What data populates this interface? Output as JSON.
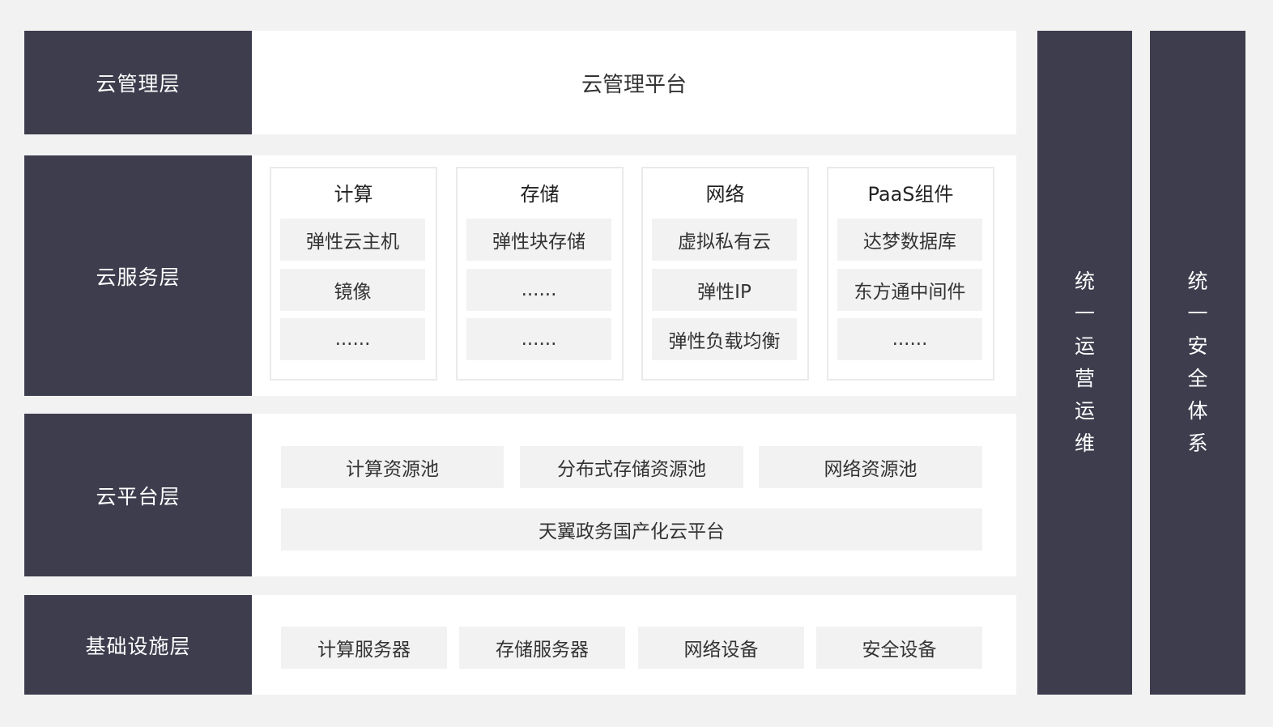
{
  "layers": {
    "management": {
      "label": "云管理层",
      "platform": "云管理平台"
    },
    "service": {
      "label": "云服务层",
      "cards": [
        {
          "title": "计算",
          "items": [
            "弹性云主机",
            "镜像",
            "......"
          ]
        },
        {
          "title": "存储",
          "items": [
            "弹性块存储",
            "......",
            "......"
          ]
        },
        {
          "title": "网络",
          "items": [
            "虚拟私有云",
            "弹性IP",
            "弹性负载均衡"
          ]
        },
        {
          "title": "PaaS组件",
          "items": [
            "达梦数据库",
            "东方通中间件",
            "......"
          ]
        }
      ]
    },
    "platform": {
      "label": "云平台层",
      "pools": [
        "计算资源池",
        "分布式存储资源池",
        "网络资源池"
      ],
      "base": "天翼政务国产化云平台"
    },
    "infrastructure": {
      "label": "基础设施层",
      "items": [
        "计算服务器",
        "存储服务器",
        "网络设备",
        "安全设备"
      ]
    }
  },
  "side_bars": [
    {
      "chars": [
        "统",
        "一",
        "运",
        "营",
        "运",
        "维"
      ]
    },
    {
      "chars": [
        "统",
        "一",
        "安",
        "全",
        "体",
        "系"
      ]
    }
  ]
}
